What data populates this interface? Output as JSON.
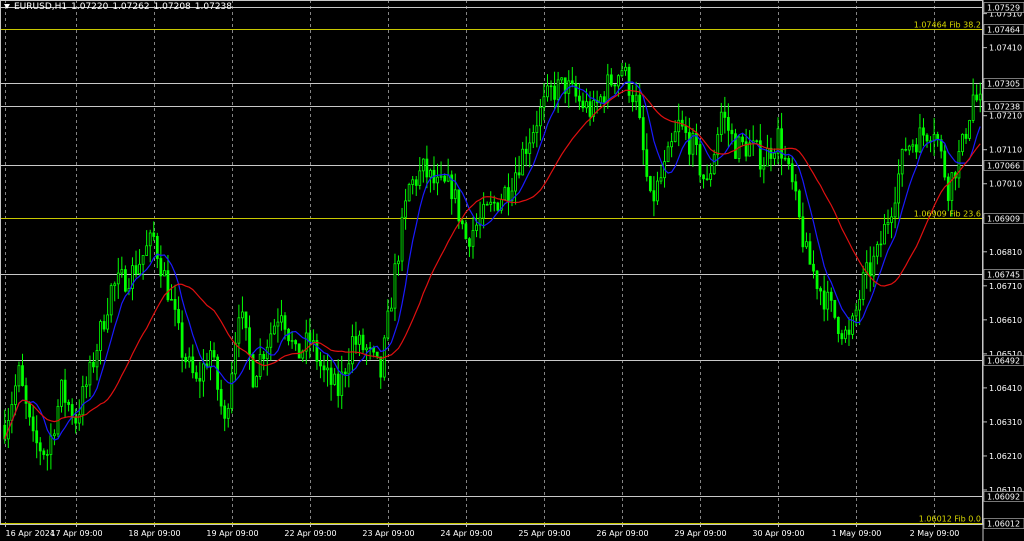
{
  "header": {
    "symbol": "EURUSD,H1",
    "open": "1.07220",
    "high": "1.07262",
    "low": "1.07208",
    "close": "1.07238"
  },
  "colors": {
    "background": "#000000",
    "grid": "#bcbcbc",
    "candle": "#00ff00",
    "ma_fast": "#1a1aff",
    "ma_slow": "#e01010",
    "level_white": "#c8c8c8",
    "level_fib": "#c8c800",
    "fib_label": "#d8d800",
    "axis_text": "#ffffff"
  },
  "chart_data": {
    "type": "candlestick",
    "grid": true,
    "legend": "none",
    "ylim": [
      1.0601,
      1.0755
    ],
    "y_ticks": [
      "1.07510",
      "1.07410",
      "1.07310",
      "1.07210",
      "1.07110",
      "1.07010",
      "1.06910",
      "1.06810",
      "1.06710",
      "1.06610",
      "1.06510",
      "1.06410",
      "1.06310",
      "1.06210",
      "1.06110",
      "1.06010"
    ],
    "x_ticks": [
      {
        "bar": 0,
        "label": "16 Apr 2024"
      },
      {
        "bar": 20,
        "label": "17 Apr 09:00"
      },
      {
        "bar": 42,
        "label": "18 Apr 09:00"
      },
      {
        "bar": 64,
        "label": "19 Apr 09:00"
      },
      {
        "bar": 86,
        "label": "22 Apr 09:00"
      },
      {
        "bar": 108,
        "label": "23 Apr 09:00"
      },
      {
        "bar": 130,
        "label": "24 Apr 09:00"
      },
      {
        "bar": 152,
        "label": "25 Apr 09:00"
      },
      {
        "bar": 174,
        "label": "26 Apr 09:00"
      },
      {
        "bar": 196,
        "label": "29 Apr 09:00"
      },
      {
        "bar": 218,
        "label": "30 Apr 09:00"
      },
      {
        "bar": 240,
        "label": "1 May 09:00"
      },
      {
        "bar": 262,
        "label": "2 May 09:00"
      }
    ],
    "bar_count": 276,
    "close_path": [
      [
        0,
        1.063
      ],
      [
        4,
        1.0645
      ],
      [
        8,
        1.0625
      ],
      [
        12,
        1.0622
      ],
      [
        16,
        1.064
      ],
      [
        20,
        1.0632
      ],
      [
        24,
        1.0645
      ],
      [
        30,
        1.067
      ],
      [
        36,
        1.0675
      ],
      [
        42,
        1.0685
      ],
      [
        46,
        1.067
      ],
      [
        50,
        1.0652
      ],
      [
        54,
        1.0642
      ],
      [
        58,
        1.0652
      ],
      [
        62,
        1.063
      ],
      [
        66,
        1.0665
      ],
      [
        70,
        1.0645
      ],
      [
        74,
        1.0655
      ],
      [
        78,
        1.0665
      ],
      [
        82,
        1.065
      ],
      [
        86,
        1.0655
      ],
      [
        90,
        1.0645
      ],
      [
        94,
        1.064
      ],
      [
        98,
        1.0655
      ],
      [
        102,
        1.0652
      ],
      [
        106,
        1.0645
      ],
      [
        110,
        1.0675
      ],
      [
        114,
        1.07
      ],
      [
        118,
        1.0705
      ],
      [
        122,
        1.07
      ],
      [
        126,
        1.07
      ],
      [
        130,
        1.0685
      ],
      [
        134,
        1.069
      ],
      [
        138,
        1.0695
      ],
      [
        142,
        1.07
      ],
      [
        146,
        1.071
      ],
      [
        150,
        1.072
      ],
      [
        154,
        1.0728
      ],
      [
        158,
        1.073
      ],
      [
        162,
        1.0725
      ],
      [
        166,
        1.0722
      ],
      [
        170,
        1.073
      ],
      [
        174,
        1.0735
      ],
      [
        178,
        1.0725
      ],
      [
        182,
        1.0695
      ],
      [
        186,
        1.0705
      ],
      [
        190,
        1.0718
      ],
      [
        194,
        1.0712
      ],
      [
        198,
        1.07
      ],
      [
        202,
        1.0722
      ],
      [
        206,
        1.0712
      ],
      [
        210,
        1.0712
      ],
      [
        214,
        1.0708
      ],
      [
        218,
        1.0715
      ],
      [
        222,
        1.07
      ],
      [
        226,
        1.068
      ],
      [
        230,
        1.067
      ],
      [
        234,
        1.0662
      ],
      [
        238,
        1.0655
      ],
      [
        242,
        1.0672
      ],
      [
        246,
        1.068
      ],
      [
        250,
        1.0695
      ],
      [
        254,
        1.0712
      ],
      [
        258,
        1.0715
      ],
      [
        262,
        1.0718
      ],
      [
        266,
        1.07
      ],
      [
        270,
        1.0712
      ],
      [
        273,
        1.0727
      ],
      [
        275,
        1.0724
      ]
    ],
    "levels": [
      {
        "value": "1.07529",
        "price": 1.07529,
        "kind": "white",
        "label": ""
      },
      {
        "value": "1.07464",
        "price": 1.07464,
        "kind": "fib",
        "label": "1.07464 Fib 38.2"
      },
      {
        "value": "1.07305",
        "price": 1.07305,
        "kind": "white",
        "label": ""
      },
      {
        "value": "1.07238",
        "price": 1.07238,
        "kind": "white",
        "label": ""
      },
      {
        "value": "1.07066",
        "price": 1.07066,
        "kind": "white",
        "label": ""
      },
      {
        "value": "1.06909",
        "price": 1.06909,
        "kind": "fib",
        "label": "1.06909 Fib 23.6"
      },
      {
        "value": "1.06745",
        "price": 1.06745,
        "kind": "white",
        "label": ""
      },
      {
        "value": "1.06492",
        "price": 1.06492,
        "kind": "white",
        "label": ""
      },
      {
        "value": "1.06092",
        "price": 1.06092,
        "kind": "white",
        "label": ""
      },
      {
        "value": "1.06012",
        "price": 1.06012,
        "kind": "fib",
        "label": "1.06012 Fib 0.0"
      }
    ]
  }
}
